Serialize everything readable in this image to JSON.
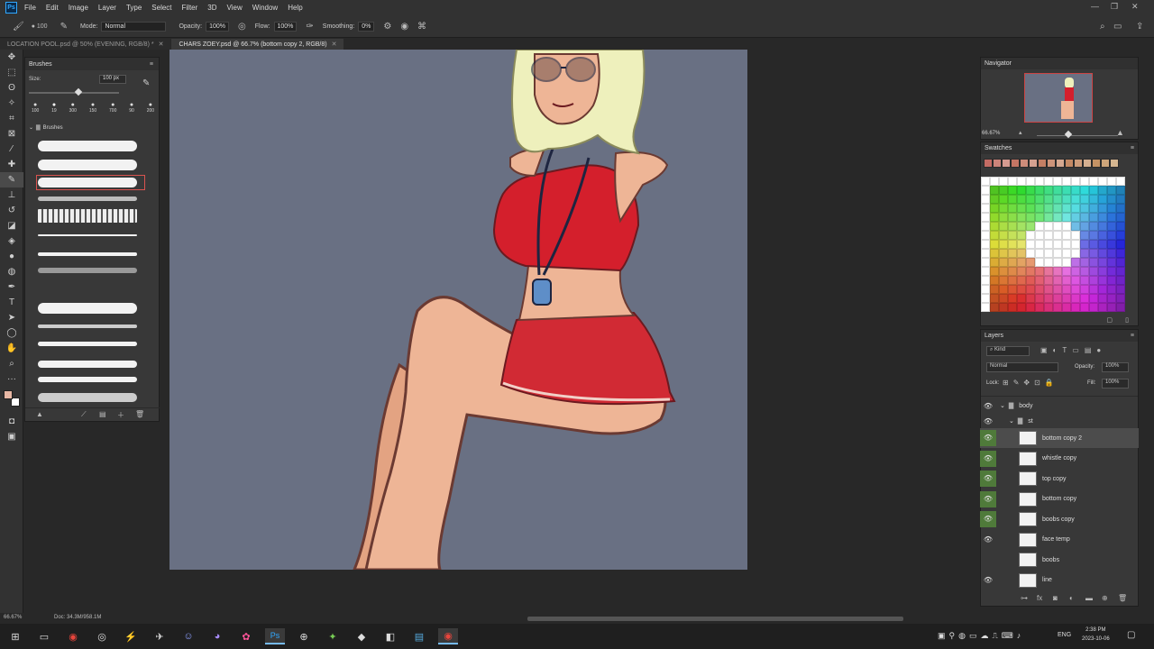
{
  "menu": {
    "app_icon": "Ps",
    "items": [
      "File",
      "Edit",
      "Image",
      "Layer",
      "Type",
      "Select",
      "Filter",
      "3D",
      "View",
      "Window",
      "Help"
    ]
  },
  "options": {
    "brush_size": "100",
    "mode_label": "Mode:",
    "mode_value": "Normal",
    "opacity_label": "Opacity:",
    "opacity_value": "100%",
    "flow_label": "Flow:",
    "flow_value": "100%",
    "smoothing_label": "Smoothing:",
    "smoothing_value": "0%"
  },
  "tabs": [
    {
      "label": "LOCATION POOL.psd @ 50% (EVENING, RGB/8) *",
      "active": false
    },
    {
      "label": "CHARS ZOEY.psd @ 66.7% (bottom copy 2, RGB/8)",
      "active": true
    }
  ],
  "brushes_panel": {
    "title": "Brushes",
    "size_label": "Size:",
    "size_value": "100 px",
    "presets": [
      "100",
      "19",
      "300",
      "150",
      "700",
      "90",
      "200"
    ],
    "group_label": "Brushes"
  },
  "navigator": {
    "title": "Navigator",
    "zoom": "66.67%"
  },
  "swatches": {
    "title": "Swatches"
  },
  "layers_panel": {
    "title": "Layers",
    "filter_kind": "Kind",
    "blend_mode": "Normal",
    "opacity_label": "Opacity:",
    "opacity_value": "100%",
    "lock_label": "Lock:",
    "fill_label": "Fill:",
    "fill_value": "100%",
    "groups": [
      "body",
      "st"
    ],
    "layers": [
      {
        "name": "bottom copy 2",
        "selected": true,
        "visible": true
      },
      {
        "name": "whistle copy",
        "selected": false,
        "visible": true
      },
      {
        "name": "top copy",
        "selected": false,
        "visible": true
      },
      {
        "name": "bottom copy",
        "selected": false,
        "visible": true
      },
      {
        "name": "boobs copy",
        "selected": false,
        "visible": true
      },
      {
        "name": "face temp",
        "selected": false,
        "visible": true
      },
      {
        "name": "boobs",
        "selected": false,
        "visible": false
      },
      {
        "name": "line",
        "selected": false,
        "visible": true
      }
    ]
  },
  "status": {
    "zoom": "66.67%",
    "doc": "Doc: 34.3M/958.1M"
  },
  "taskbar": {
    "lang": "ENG",
    "time": "2:38 PM",
    "date": "2023-10-06"
  },
  "colors": {
    "artboard": "#697083",
    "panel": "#383838",
    "accent": "#31a8ff",
    "fg_color": "#e8b8a5",
    "bg_color": "#ffffff"
  }
}
